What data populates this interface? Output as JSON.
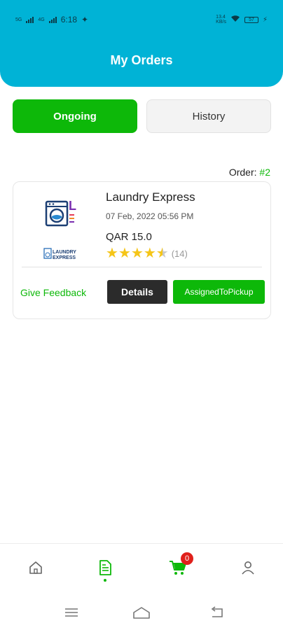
{
  "status_bar": {
    "network_1": "5G",
    "network_2": "4G",
    "time": "6:18",
    "speed": "13.4",
    "speed_unit": "KB/s",
    "battery": "57"
  },
  "header": {
    "title": "My Orders"
  },
  "tabs": [
    {
      "label": "Ongoing",
      "active": true
    },
    {
      "label": "History",
      "active": false
    }
  ],
  "order_count": {
    "label": "Order: ",
    "value": "#2"
  },
  "order": {
    "shop_name": "Laundry Express",
    "date": "07 Feb, 2022 05:56 PM",
    "price": "QAR 15.0",
    "rating": 4.5,
    "review_count": "(14)",
    "logo_letter": "L",
    "logo_text_1": "LAUNDRY",
    "logo_text_2": "EXPRESS",
    "feedback_label": "Give Feedback",
    "details_label": "Details",
    "status_label": "AssignedToPickup"
  },
  "bottom_nav": {
    "items": [
      {
        "icon": "home-icon"
      },
      {
        "icon": "orders-icon",
        "active": true
      },
      {
        "icon": "cart-icon",
        "badge": "0"
      },
      {
        "icon": "profile-icon"
      }
    ]
  },
  "system_nav": {
    "items": [
      "menu-icon",
      "home-icon",
      "back-icon"
    ]
  },
  "colors": {
    "primary": "#00b3d6",
    "accent": "#0db809",
    "dark": "#2b2b2b",
    "star": "#f5c518",
    "badge": "#e0201b"
  }
}
